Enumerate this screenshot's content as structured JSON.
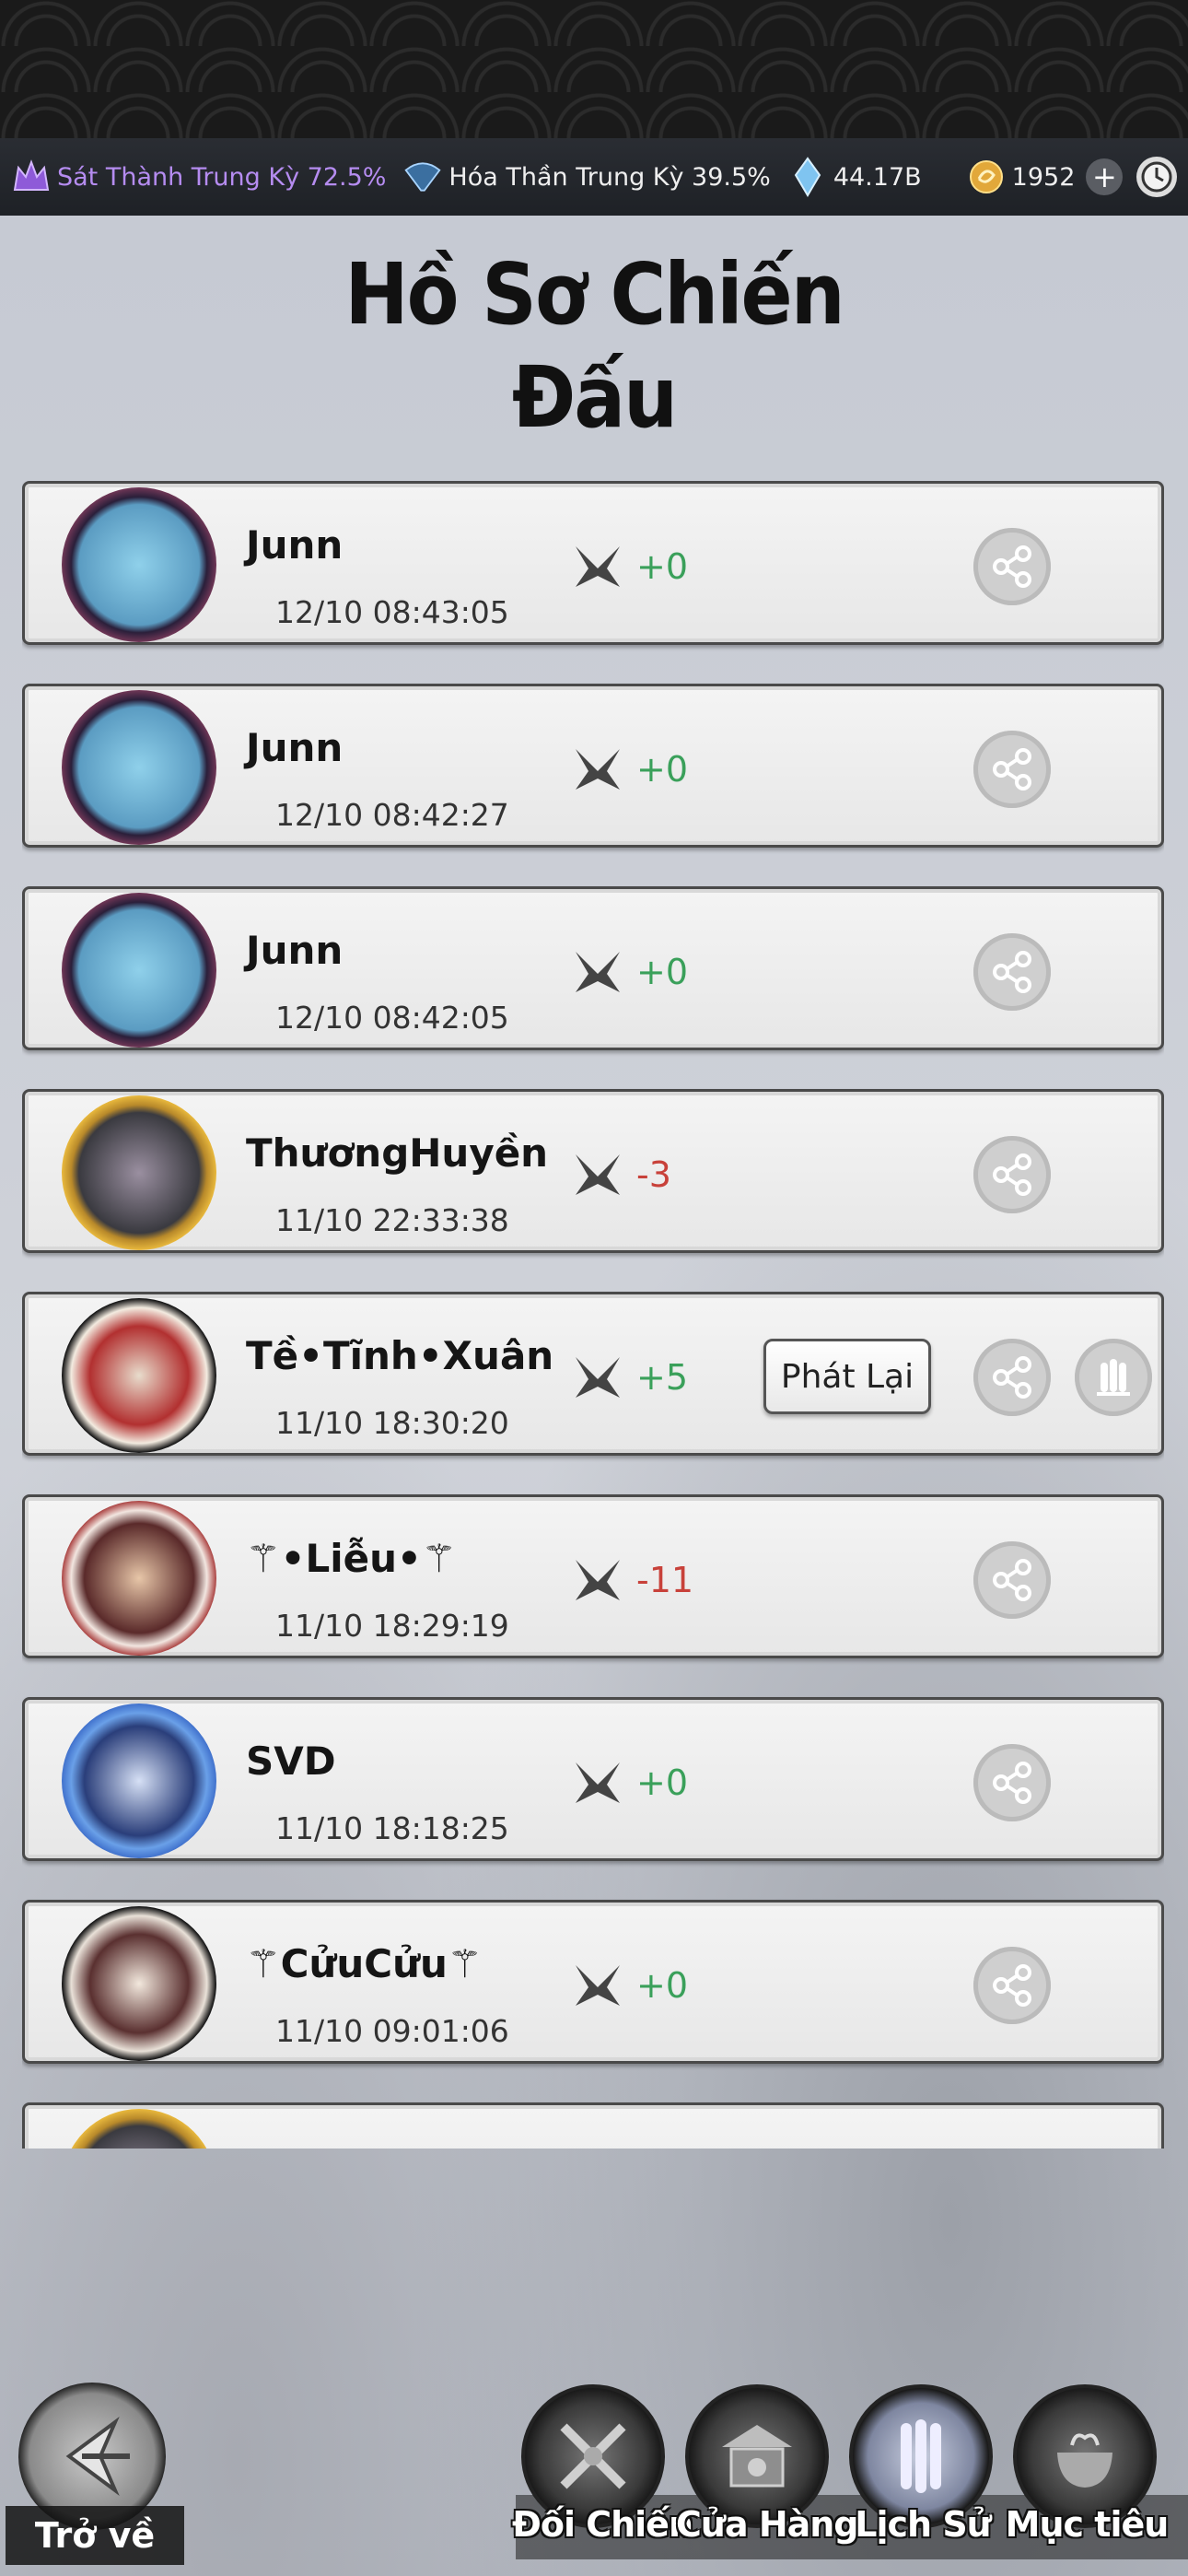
{
  "status_bar": {
    "stat1": "Sát Thành Trung Kỳ 72.5%",
    "stat2": "Hóa Thần Trung Kỳ 39.5%",
    "crystals": "44.17B",
    "coins": "1952",
    "plus": "+"
  },
  "page": {
    "title_line1": "Hồ Sơ Chiến",
    "title_line2": "Đấu"
  },
  "records": [
    {
      "name": "Junn",
      "time": "12/10  08:43:05",
      "score": "+0",
      "sign": "pos",
      "avatar": "a"
    },
    {
      "name": "Junn",
      "time": "12/10  08:42:27",
      "score": "+0",
      "sign": "pos",
      "avatar": "a"
    },
    {
      "name": "Junn",
      "time": "12/10  08:42:05",
      "score": "+0",
      "sign": "pos",
      "avatar": "a"
    },
    {
      "name": "ThươngHuyền",
      "time": "11/10  22:33:38",
      "score": "-3",
      "sign": "neg",
      "avatar": "b"
    },
    {
      "name": "Tề•Tĩnh•Xuân",
      "time": "11/10  18:30:20",
      "score": "+5",
      "sign": "pos",
      "avatar": "c",
      "replay": "Phát Lại"
    },
    {
      "name": "⚚•Liễu•⚚",
      "time": "11/10  18:29:19",
      "score": "-11",
      "sign": "neg",
      "avatar": "d"
    },
    {
      "name": "SVD",
      "time": "11/10  18:18:25",
      "score": "+0",
      "sign": "pos",
      "avatar": "e"
    },
    {
      "name": "⚚CửuCửu⚚",
      "time": "11/10  09:01:06",
      "score": "+0",
      "sign": "pos",
      "avatar": "f"
    }
  ],
  "nav": {
    "back": "Trở về",
    "items": [
      "Đối Chiến",
      "Cửa Hàng",
      "Lịch Sử",
      "Mục tiêu"
    ]
  },
  "colors": {
    "positive": "#3aa05a",
    "negative": "#c8413a",
    "accent_purple": "#b58cf0"
  }
}
